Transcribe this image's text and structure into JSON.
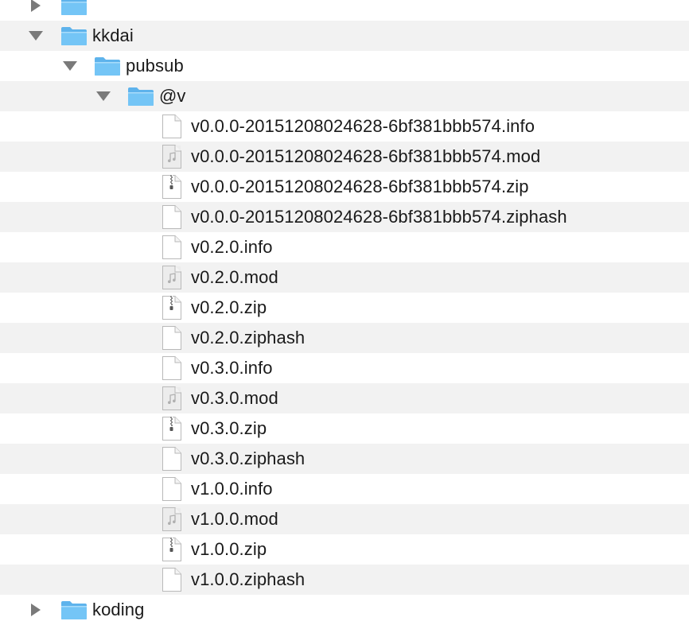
{
  "tree": {
    "rows": [
      {
        "label": "",
        "depth": 0,
        "kind": "folder",
        "state": "collapsed",
        "icon": "folder-icon",
        "partial": "top"
      },
      {
        "label": "kkdai",
        "depth": 0,
        "kind": "folder",
        "state": "expanded",
        "icon": "folder-icon"
      },
      {
        "label": "pubsub",
        "depth": 1,
        "kind": "folder",
        "state": "expanded",
        "icon": "folder-icon"
      },
      {
        "label": "@v",
        "depth": 2,
        "kind": "folder",
        "state": "expanded",
        "icon": "folder-icon"
      },
      {
        "label": "v0.0.0-20151208024628-6bf381bbb574.info",
        "depth": 3,
        "kind": "file",
        "icon": "document-icon"
      },
      {
        "label": "v0.0.0-20151208024628-6bf381bbb574.mod",
        "depth": 3,
        "kind": "file",
        "icon": "music-document-icon"
      },
      {
        "label": "v0.0.0-20151208024628-6bf381bbb574.zip",
        "depth": 3,
        "kind": "file",
        "icon": "zip-archive-icon"
      },
      {
        "label": "v0.0.0-20151208024628-6bf381bbb574.ziphash",
        "depth": 3,
        "kind": "file",
        "icon": "document-icon"
      },
      {
        "label": "v0.2.0.info",
        "depth": 3,
        "kind": "file",
        "icon": "document-icon"
      },
      {
        "label": "v0.2.0.mod",
        "depth": 3,
        "kind": "file",
        "icon": "music-document-icon"
      },
      {
        "label": "v0.2.0.zip",
        "depth": 3,
        "kind": "file",
        "icon": "zip-archive-icon"
      },
      {
        "label": "v0.2.0.ziphash",
        "depth": 3,
        "kind": "file",
        "icon": "document-icon"
      },
      {
        "label": "v0.3.0.info",
        "depth": 3,
        "kind": "file",
        "icon": "document-icon"
      },
      {
        "label": "v0.3.0.mod",
        "depth": 3,
        "kind": "file",
        "icon": "music-document-icon"
      },
      {
        "label": "v0.3.0.zip",
        "depth": 3,
        "kind": "file",
        "icon": "zip-archive-icon"
      },
      {
        "label": "v0.3.0.ziphash",
        "depth": 3,
        "kind": "file",
        "icon": "document-icon"
      },
      {
        "label": "v1.0.0.info",
        "depth": 3,
        "kind": "file",
        "icon": "document-icon"
      },
      {
        "label": "v1.0.0.mod",
        "depth": 3,
        "kind": "file",
        "icon": "music-document-icon"
      },
      {
        "label": "v1.0.0.zip",
        "depth": 3,
        "kind": "file",
        "icon": "zip-archive-icon"
      },
      {
        "label": "v1.0.0.ziphash",
        "depth": 3,
        "kind": "file",
        "icon": "document-icon"
      },
      {
        "label": "koding",
        "depth": 0,
        "kind": "folder",
        "state": "collapsed",
        "icon": "folder-icon",
        "partial": "bottom"
      }
    ]
  },
  "colors": {
    "row_alt": "#f2f2f2",
    "folder_body": "#74c5f6",
    "folder_tab": "#5eb3ec",
    "disclosure": "#7a7a7a",
    "file_stroke": "#b9b9b9"
  }
}
